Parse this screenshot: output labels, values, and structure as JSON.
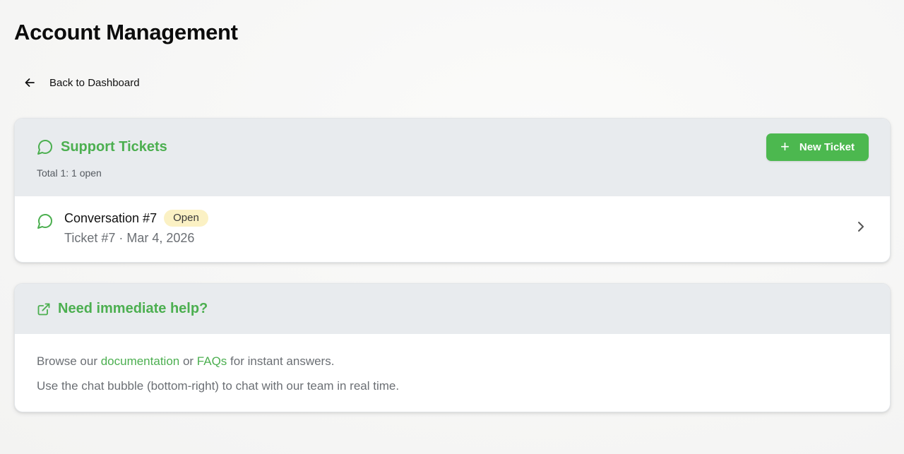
{
  "page": {
    "title": "Account Management",
    "back_label": "Back to Dashboard"
  },
  "tickets": {
    "title": "Support Tickets",
    "summary": "Total 1: 1 open",
    "new_button_label": "New Ticket",
    "items": [
      {
        "title": "Conversation #7",
        "status": "Open",
        "meta": "Ticket #7 · Mar 4, 2026"
      }
    ]
  },
  "help": {
    "title": "Need immediate help?",
    "line1_prefix": "Browse our ",
    "docs_link": "documentation",
    "line1_middle": " or ",
    "faqs_link": "FAQs",
    "line1_suffix": " for instant answers.",
    "line2": "Use the chat bubble (bottom-right) to chat with our team in real time."
  },
  "colors": {
    "accent": "#4caf50",
    "button": "#4cb84f",
    "header_bg": "#e8ebee",
    "badge_bg": "#fbf1c4"
  },
  "icons": {
    "back": "arrow-left-icon",
    "tickets": "chat-bubble-icon",
    "new": "plus-icon",
    "ticket_row": "chat-bubble-icon",
    "chevron": "chevron-right-icon",
    "help": "external-link-icon"
  }
}
